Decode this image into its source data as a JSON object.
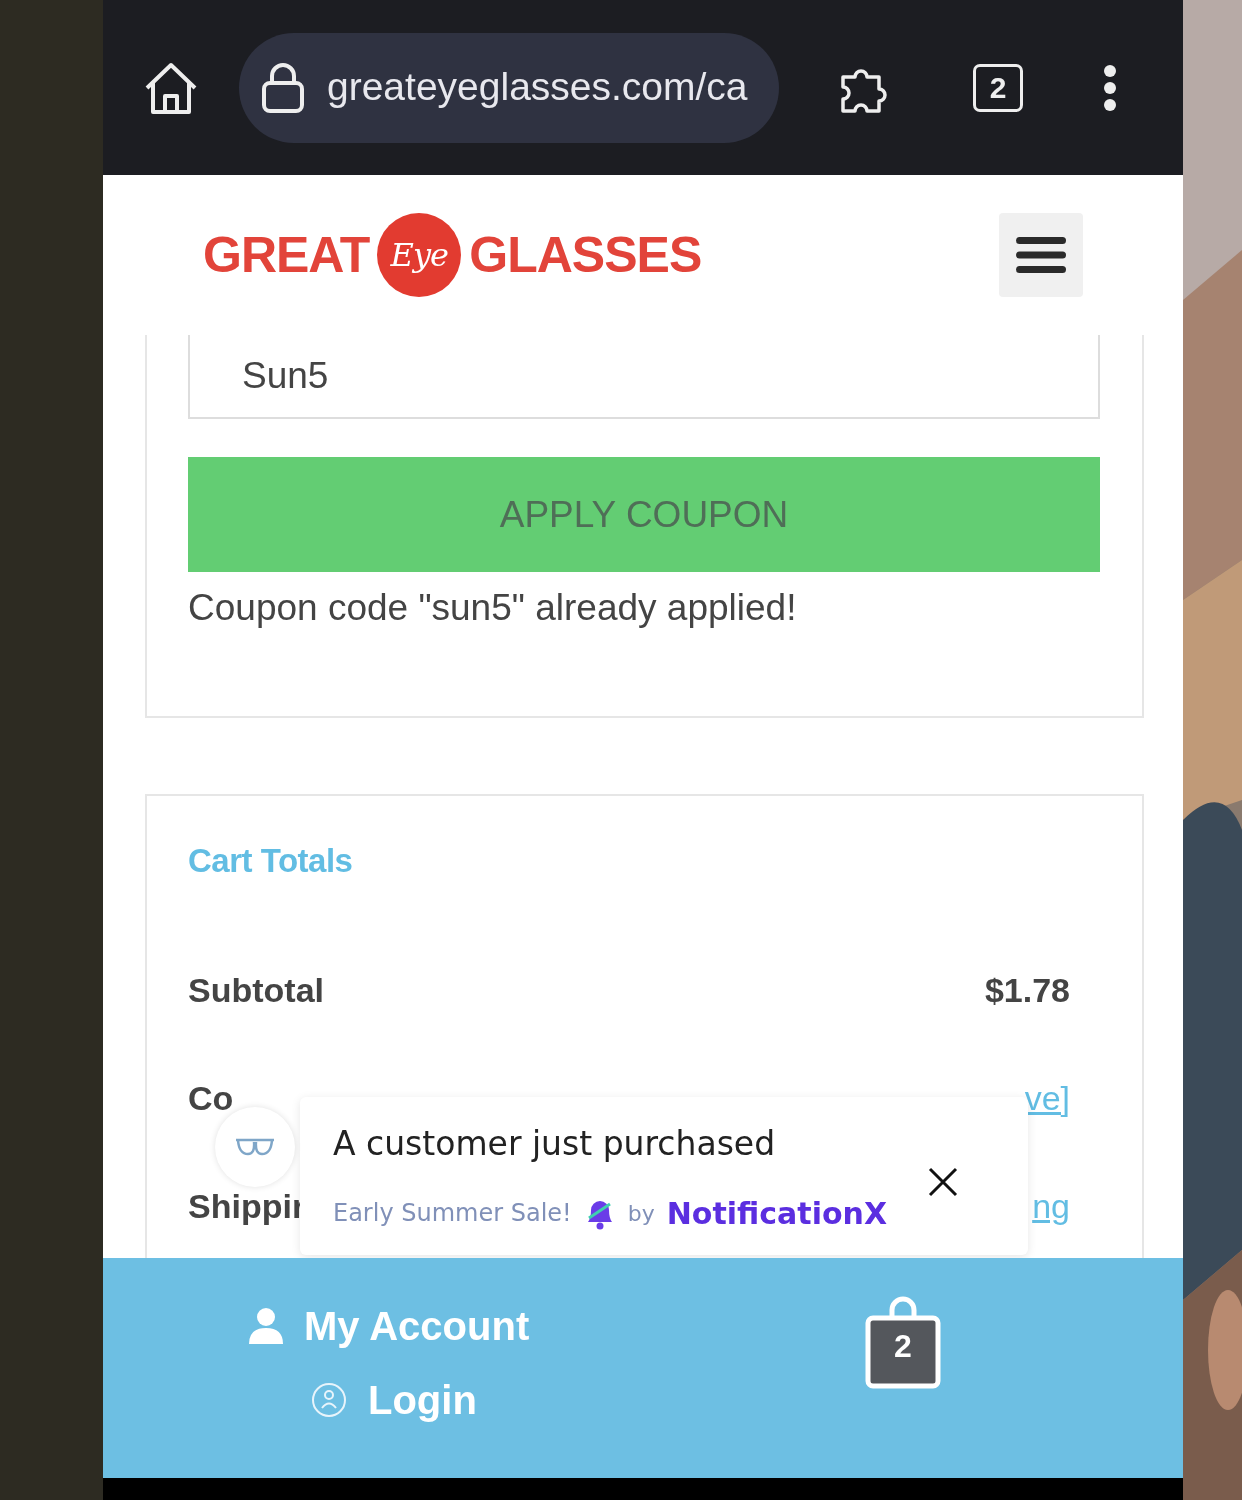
{
  "browser": {
    "url": "greateyeglasses.com/ca",
    "tab_count": "2"
  },
  "logo": {
    "left": "GREAT",
    "badge": "Eye",
    "right": "GLASSES"
  },
  "coupon": {
    "value": "Sun5",
    "button": "APPLY COUPON",
    "message": "Coupon code \"sun5\" already applied!"
  },
  "cart_totals": {
    "title": "Cart Totals",
    "rows": [
      {
        "label": "Subtotal",
        "value": "$1.78",
        "kind": "amount"
      },
      {
        "label": "Co",
        "value": "ve]",
        "kind": "link"
      },
      {
        "label": "Shippir",
        "value": "ng",
        "kind": "link"
      }
    ]
  },
  "notification": {
    "title": "A customer just purchased",
    "campaign": "Early Summer Sale!",
    "by": "by",
    "brand": "NotificationX"
  },
  "bottom_bar": {
    "account": "My Account",
    "login": "Login",
    "cart_count": "2"
  }
}
